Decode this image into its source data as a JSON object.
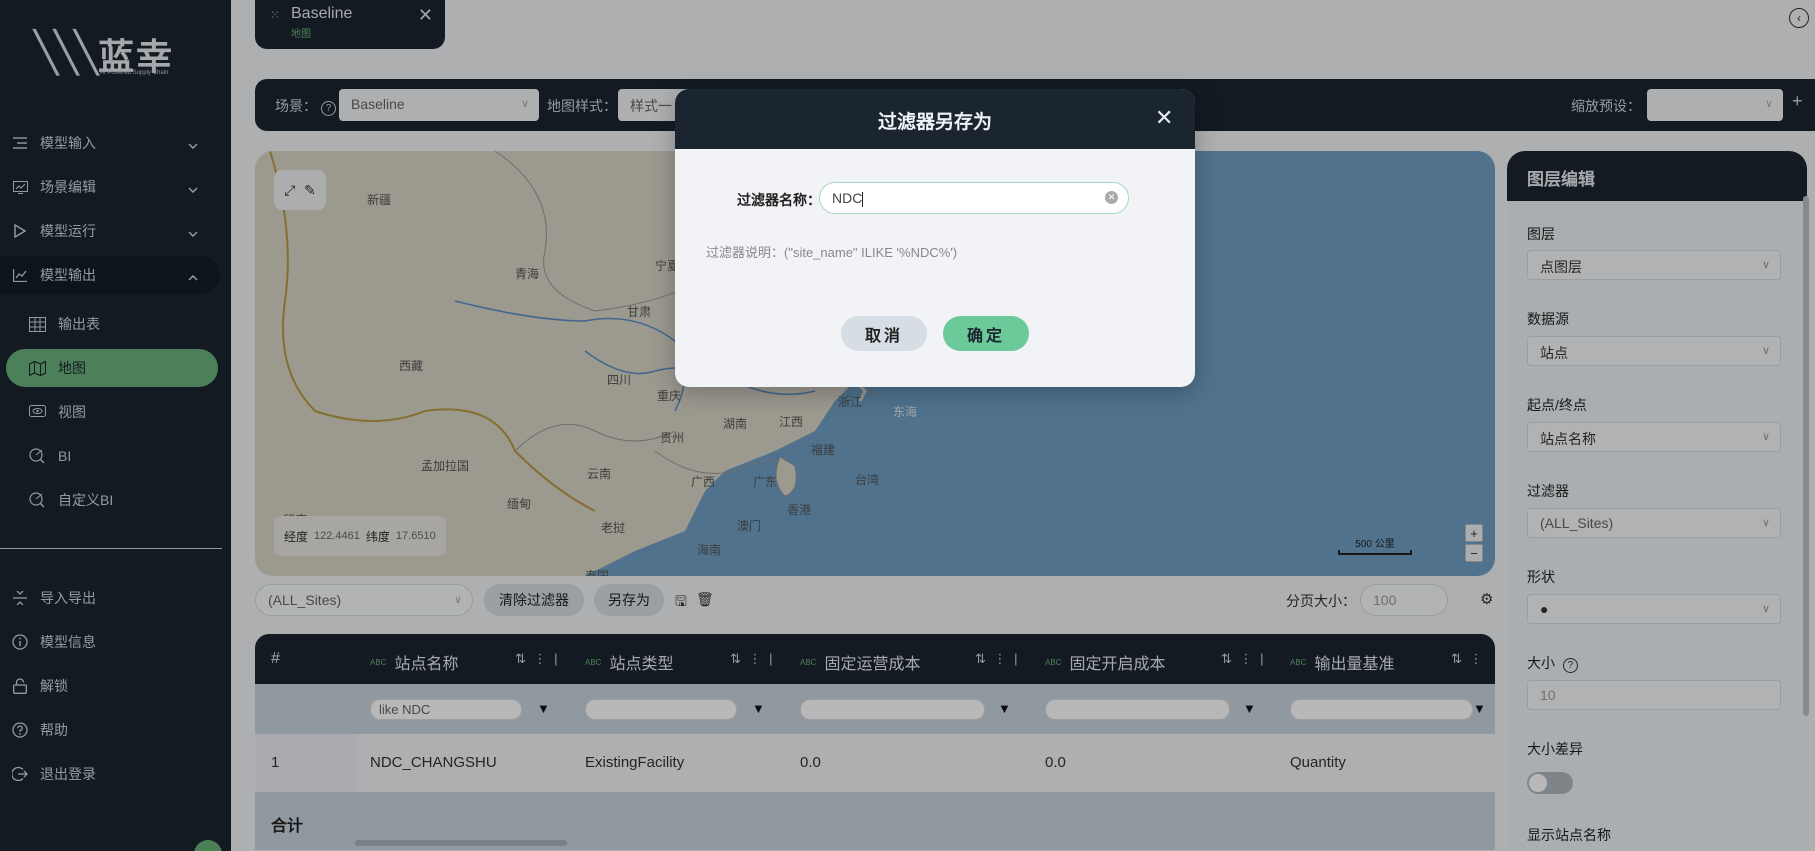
{
  "brand": {
    "name": "蓝幸",
    "tagline": "AI Powered Supply Chain"
  },
  "sidebar": {
    "groups": [
      {
        "label": "模型输入",
        "icon": "list-icon"
      },
      {
        "label": "场景编辑",
        "icon": "monitor-chart-icon"
      },
      {
        "label": "模型运行",
        "icon": "play-icon"
      },
      {
        "label": "模型输出",
        "icon": "line-chart-icon"
      }
    ],
    "sub_items": [
      {
        "label": "输出表",
        "icon": "table-icon"
      },
      {
        "label": "地图",
        "icon": "map-icon"
      },
      {
        "label": "视图",
        "icon": "eye-icon"
      },
      {
        "label": "BI",
        "icon": "bi-icon"
      },
      {
        "label": "自定义BI",
        "icon": "custom-bi-icon"
      }
    ],
    "bottom": [
      {
        "label": "导入导出",
        "icon": "import-export-icon"
      },
      {
        "label": "模型信息",
        "icon": "info-icon"
      },
      {
        "label": "解锁",
        "icon": "unlock-icon"
      },
      {
        "label": "帮助",
        "icon": "help-icon"
      },
      {
        "label": "退出登录",
        "icon": "logout-icon"
      }
    ]
  },
  "tab": {
    "title": "Baseline",
    "subtitle": "地图"
  },
  "toolbar": {
    "scenario_label": "场景：",
    "scenario_value": "Baseline",
    "map_style_label": "地图样式：",
    "map_style_value": "样式一",
    "zoom_preset_label": "缩放预设：",
    "zoom_preset_value": ""
  },
  "map": {
    "labels": [
      "新疆",
      "青海",
      "甘肃",
      "宁夏",
      "西藏",
      "四川",
      "重庆",
      "湖南",
      "江西",
      "浙江",
      "东海",
      "贵州",
      "福建",
      "云南",
      "广西",
      "广东",
      "台湾",
      "香港",
      "澳门",
      "海南",
      "孟加拉国",
      "缅甸",
      "老挝",
      "印度",
      "泰国"
    ],
    "coords": {
      "lng_label": "经度",
      "lng_value": "122.4461",
      "lat_label": "纬度",
      "lat_value": "17.6510"
    },
    "scale_label": "500 公里"
  },
  "filter_bar": {
    "filter_value": "(ALL_Sites)",
    "clear_button": "清除过滤器",
    "save_as_button": "另存为",
    "page_size_label": "分页大小：",
    "page_size_value": "100"
  },
  "table": {
    "index_header": "#",
    "columns": [
      {
        "tag": "ABC",
        "label": "站点名称",
        "filter": "like NDC"
      },
      {
        "tag": "ABC",
        "label": "站点类型",
        "filter": ""
      },
      {
        "tag": "ABC",
        "label": "固定运营成本",
        "filter": ""
      },
      {
        "tag": "ABC",
        "label": "固定开启成本",
        "filter": ""
      },
      {
        "tag": "ABC",
        "label": "输出量基准",
        "filter": ""
      }
    ],
    "rows": [
      [
        "1",
        "NDC_CHANGSHU",
        "ExistingFacility",
        "0.0",
        "0.0",
        "Quantity"
      ]
    ],
    "total_label": "合计"
  },
  "right_panel": {
    "title": "图层编辑",
    "layer_label": "图层",
    "layer_value": "点图层",
    "datasource_label": "数据源",
    "datasource_value": "站点",
    "endpoint_label": "起点/终点",
    "endpoint_value": "站点名称",
    "filter_label": "过滤器",
    "filter_value": "(ALL_Sites)",
    "shape_label": "形状",
    "shape_value": "●",
    "size_label": "大小",
    "size_value": "10",
    "size_diff_label": "大小差异",
    "show_site_name_label": "显示站点名称"
  },
  "modal": {
    "title": "过滤器另存为",
    "name_label": "过滤器名称：",
    "name_value": "NDC",
    "description": "过滤器说明：(\"site_name\" ILIKE '%NDC%')",
    "cancel_label": "取消",
    "ok_label": "确定"
  },
  "colors": {
    "dark": "#1b2530",
    "accent": "#6ab27a",
    "ok_button": "#6cc99a",
    "map_water": "#6f9fc4",
    "map_land": "#d9d4c6"
  }
}
